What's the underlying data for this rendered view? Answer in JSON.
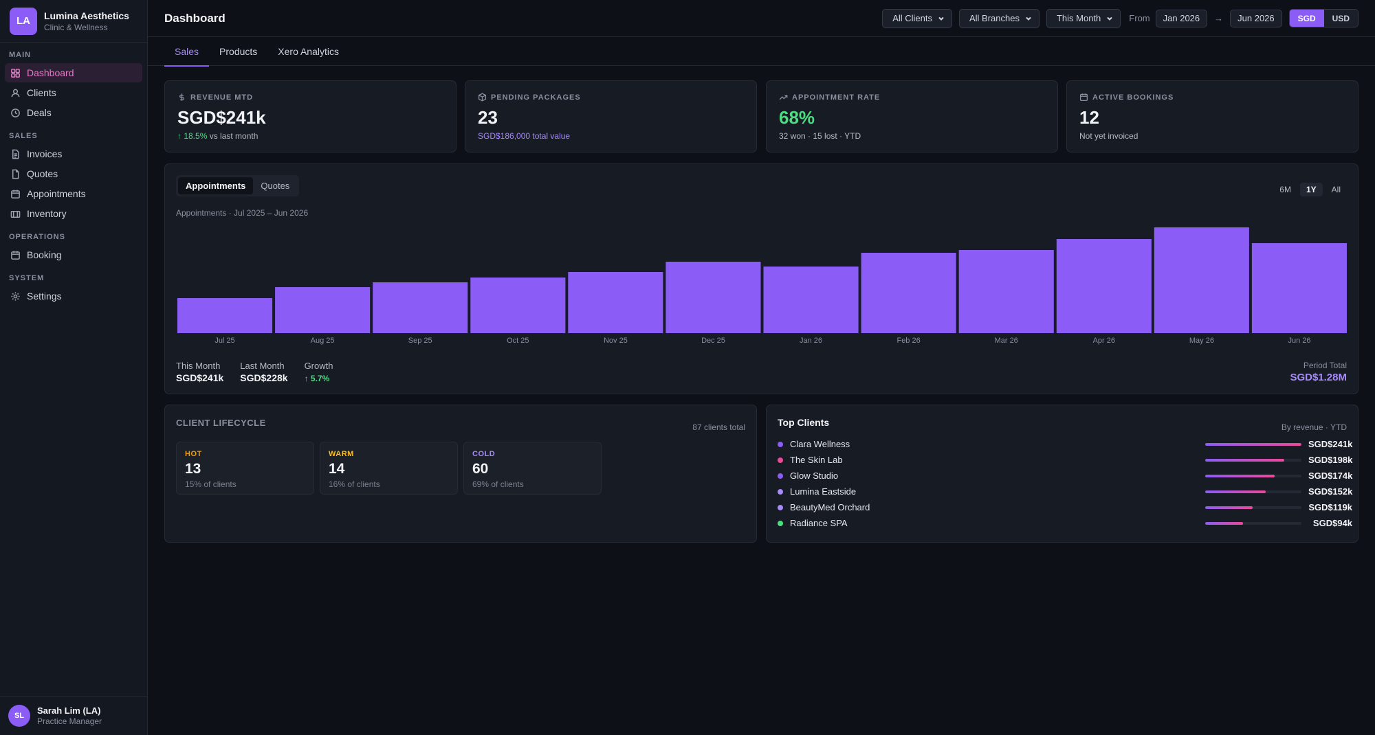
{
  "brand": {
    "initials": "LA",
    "name": "Lumina Aesthetics",
    "subtitle": "Clinic & Wellness",
    "accent": "#8b5cf6"
  },
  "sidebar": {
    "sections": [
      {
        "label": "MAIN",
        "items": [
          {
            "label": "Dashboard",
            "icon": "grid-icon",
            "active": true
          },
          {
            "label": "Clients",
            "icon": "user-icon"
          },
          {
            "label": "Deals",
            "icon": "clock-icon"
          }
        ]
      },
      {
        "label": "SALES",
        "items": [
          {
            "label": "Invoices",
            "icon": "file-text-icon"
          },
          {
            "label": "Quotes",
            "icon": "file-icon"
          },
          {
            "label": "Appointments",
            "icon": "calendar-icon"
          },
          {
            "label": "Inventory",
            "icon": "box-icon"
          }
        ]
      },
      {
        "label": "OPERATIONS",
        "items": [
          {
            "label": "Booking",
            "icon": "calendar-icon"
          }
        ]
      },
      {
        "label": "SYSTEM",
        "items": [
          {
            "label": "Settings",
            "icon": "gear-icon"
          }
        ]
      }
    ]
  },
  "user": {
    "initials": "SL",
    "name": "Sarah Lim (LA)",
    "role": "Practice Manager"
  },
  "header": {
    "title": "Dashboard",
    "client_filter": "All Clients",
    "branch_filter": "All Branches",
    "period_filter": "This Month",
    "from_label": "From",
    "from_date": "Jan 2026",
    "arrow": "→",
    "to_date": "Jun 2026",
    "currencies": [
      {
        "label": "SGD",
        "active": true
      },
      {
        "label": "USD",
        "active": false
      }
    ]
  },
  "tabs": [
    {
      "label": "Sales",
      "active": true
    },
    {
      "label": "Products"
    },
    {
      "label": "Xero Analytics"
    }
  ],
  "kpis": [
    {
      "label": "REVENUE MTD",
      "icon": "dollar-icon",
      "value": "SGD$241k",
      "sub_change": "↑ 18.5%",
      "sub_text": " vs last month"
    },
    {
      "label": "PENDING PACKAGES",
      "icon": "package-icon",
      "value": "23",
      "sub_text": "SGD$186,000 total value"
    },
    {
      "label": "APPOINTMENT RATE",
      "icon": "trend-icon",
      "value": "68%",
      "sub_text": "32 won · 15 lost · YTD"
    },
    {
      "label": "ACTIVE BOOKINGS",
      "icon": "calendar-icon",
      "value": "12",
      "sub_text": "Not yet invoiced"
    }
  ],
  "chart": {
    "toggle": [
      {
        "label": "Appointments",
        "active": true
      },
      {
        "label": "Quotes"
      }
    ],
    "ranges": [
      {
        "label": "6M"
      },
      {
        "label": "1Y",
        "active": true
      },
      {
        "label": "All"
      }
    ],
    "caption": "Appointments · Jul 2025 – Jun 2026",
    "stats": [
      {
        "label": "This Month",
        "value": "SGD$241k"
      },
      {
        "label": "Last Month",
        "value": "SGD$228k"
      },
      {
        "label": "Growth",
        "value": "↑ 5.7%"
      }
    ],
    "period_label": "Period Total",
    "period_value": "SGD$1.28M"
  },
  "chart_data": {
    "type": "bar",
    "categories": [
      "Jul 25",
      "Aug 25",
      "Sep 25",
      "Oct 25",
      "Nov 25",
      "Dec 25",
      "Jan 26",
      "Feb 26",
      "Mar 26",
      "Apr 26",
      "May 26",
      "Jun 26"
    ],
    "values": [
      51,
      67,
      74,
      81,
      89,
      104,
      97,
      117,
      121,
      137,
      154,
      131
    ],
    "ylim": [
      0,
      160
    ],
    "bar_color": "#8b5cf6",
    "grid": false,
    "legend": "none"
  },
  "lifecycle": {
    "title": "CLIENT LIFECYCLE",
    "total": "87 clients total",
    "stages": [
      {
        "name": "HOT",
        "count": "13",
        "pct": "15% of clients",
        "color": "#f59e0b"
      },
      {
        "name": "WARM",
        "count": "14",
        "pct": "16% of clients",
        "color": "#fbbf24"
      },
      {
        "name": "COLD",
        "count": "60",
        "pct": "69% of clients",
        "color": "#a78bfa"
      }
    ]
  },
  "top_clients": {
    "title": "Top Clients",
    "meta": "By revenue · YTD",
    "clients": [
      {
        "name": "Clara Wellness",
        "value": "SGD$241k",
        "share": 1.0,
        "dot": "#8b5cf6"
      },
      {
        "name": "The Skin Lab",
        "value": "SGD$198k",
        "share": 0.82,
        "dot": "#ec4899"
      },
      {
        "name": "Glow Studio",
        "value": "SGD$174k",
        "share": 0.72,
        "dot": "#8b5cf6"
      },
      {
        "name": "Lumina Eastside",
        "value": "SGD$152k",
        "share": 0.63,
        "dot": "#a78bfa"
      },
      {
        "name": "BeautyMed Orchard",
        "value": "SGD$119k",
        "share": 0.49,
        "dot": "#a78bfa"
      },
      {
        "name": "Radiance SPA",
        "value": "SGD$94k",
        "share": 0.39,
        "dot": "#4ade80"
      }
    ]
  }
}
